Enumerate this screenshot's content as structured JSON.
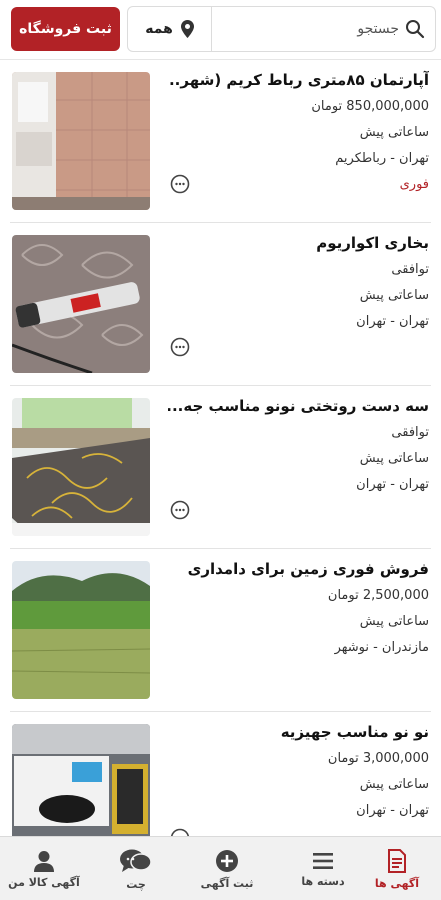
{
  "header": {
    "store_button": "ثبت فروشگاه",
    "location": "همه",
    "search_placeholder": "جستجو"
  },
  "listings": [
    {
      "title": "آپارتمان ۸۵متری رباط کریم (شهر...",
      "price": "850,000,000 تومان",
      "time": "ساعاتی پیش",
      "location": "تهران - رباطکریم",
      "tag": "فوری"
    },
    {
      "title": "بخاری اکواریوم",
      "price": "توافقی",
      "time": "ساعاتی پیش",
      "location": "تهران - تهران",
      "tag": ""
    },
    {
      "title": "سه دست روتختی نونو مناسب جه...",
      "price": "توافقی",
      "time": "ساعاتی پیش",
      "location": "تهران - تهران",
      "tag": ""
    },
    {
      "title": "فروش فوری زمین برای دامداری",
      "price": "2,500,000 تومان",
      "time": "ساعاتی پیش",
      "location": "مازندران - نوشهر",
      "tag": ""
    },
    {
      "title": "نو نو مناسب جهیزیه",
      "price": "3,000,000 تومان",
      "time": "ساعاتی پیش",
      "location": "تهران - تهران",
      "tag": ""
    }
  ],
  "nav": {
    "ads": "آگهی ها",
    "categories": "دسته ها",
    "post_ad": "ثبت آگهی",
    "chat": "چت",
    "my_ads": "آگهی کالا من"
  },
  "colors": {
    "accent": "#b22226"
  }
}
